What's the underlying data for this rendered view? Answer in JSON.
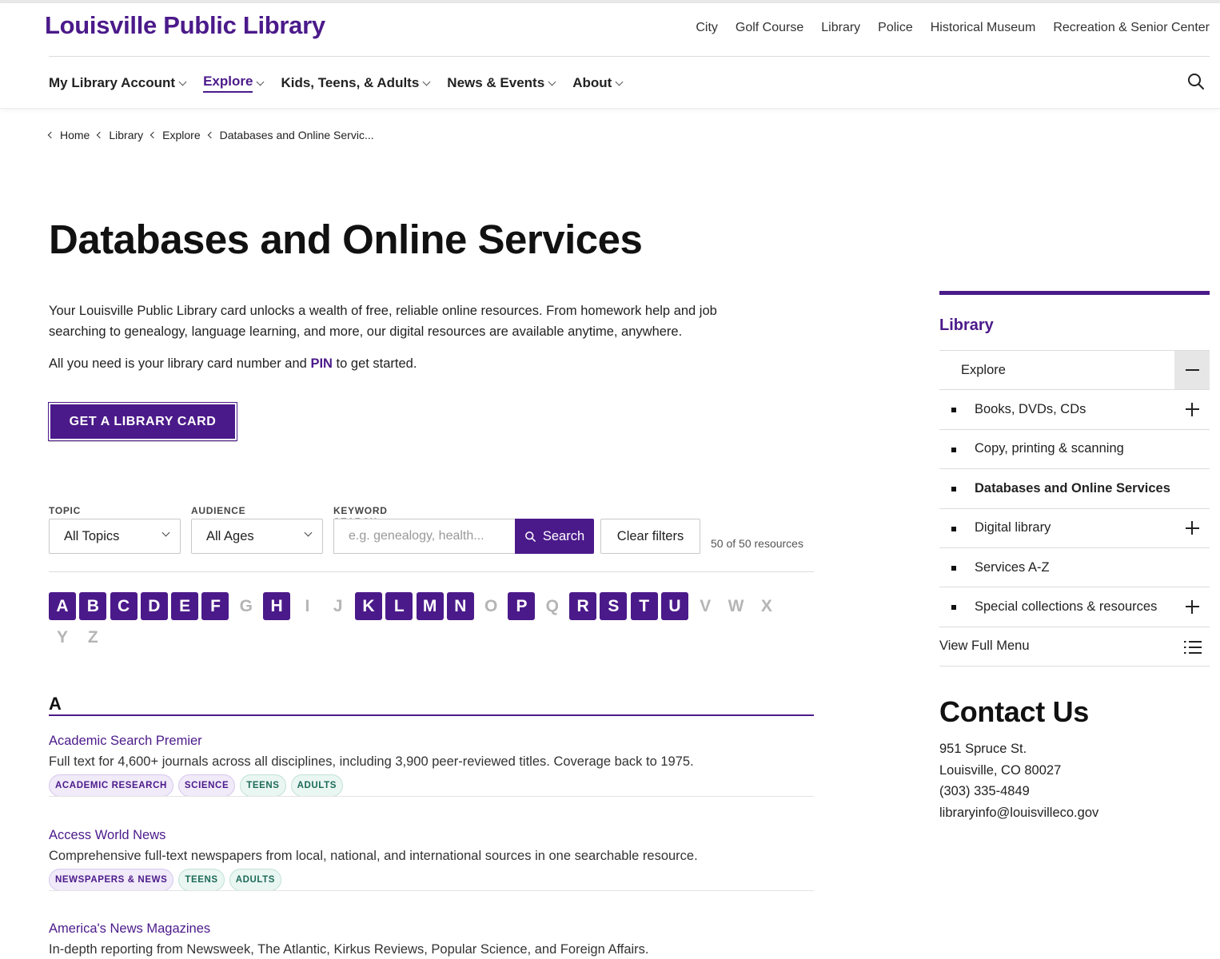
{
  "header": {
    "logo": "Louisville Public Library",
    "utility_links": [
      "City",
      "Golf Course",
      "Library",
      "Police",
      "Historical Museum",
      "Recreation & Senior Center"
    ],
    "nav": [
      {
        "label": "My Library Account",
        "active": false
      },
      {
        "label": "Explore",
        "active": true
      },
      {
        "label": "Kids, Teens, & Adults",
        "active": false
      },
      {
        "label": "News & Events",
        "active": false
      },
      {
        "label": "About",
        "active": false
      }
    ],
    "search_icon": "search-icon"
  },
  "breadcrumb": [
    "Home",
    "Library",
    "Explore",
    "Databases and Online Servic..."
  ],
  "page": {
    "title": "Databases and Online Services",
    "intro": "Your Louisville Public Library card unlocks a wealth of free, reliable online resources. From homework help and job searching to genealogy, language learning, and more, our digital resources are available anytime, anywhere.",
    "intro2_before": "All you need is your library card number and",
    "intro2_link": "PIN",
    "intro2_after": "to get started.",
    "cta": "GET A LIBRARY CARD"
  },
  "filters": {
    "topic_label": "TOPIC",
    "topic_value": "All Topics",
    "audience_label": "AUDIENCE",
    "audience_value": "All Ages",
    "keyword_label": "KEYWORD SEARCH",
    "keyword_placeholder": "e.g. genealogy, health...",
    "search_button": "Search",
    "clear_button": "Clear filters",
    "count": "50 of 50 resources"
  },
  "alphabet": {
    "enabled": [
      "A",
      "B",
      "C",
      "D",
      "E",
      "F",
      "H",
      "K",
      "L",
      "M",
      "N",
      "P",
      "R",
      "S",
      "T",
      "U"
    ],
    "letters": [
      "A",
      "B",
      "C",
      "D",
      "E",
      "F",
      "G",
      "H",
      "I",
      "J",
      "K",
      "L",
      "M",
      "N",
      "O",
      "P",
      "Q",
      "R",
      "S",
      "T",
      "U",
      "V",
      "W",
      "X",
      "Y",
      "Z"
    ]
  },
  "section_letter": "A",
  "resources": [
    {
      "title": "Academic Search Premier",
      "description": "Full text for 4,600+ journals across all disciplines, including 3,900 peer-reviewed titles. Coverage back to 1975.",
      "topic_tags": [
        "ACADEMIC RESEARCH",
        "SCIENCE"
      ],
      "audience_tags": [
        "TEENS",
        "ADULTS"
      ]
    },
    {
      "title": "Access World News",
      "description": "Comprehensive full-text newspapers from local, national, and international sources in one searchable resource.",
      "topic_tags": [
        "NEWSPAPERS & NEWS"
      ],
      "audience_tags": [
        "TEENS",
        "ADULTS"
      ]
    },
    {
      "title": "America's News Magazines",
      "description": "In-depth reporting from Newsweek, The Atlantic, Kirkus Reviews, Popular Science, and Foreign Affairs.",
      "topic_tags": [],
      "audience_tags": []
    }
  ],
  "sidebar": {
    "title": "Library",
    "parent": "Explore",
    "items": [
      {
        "label": "Books, DVDs, CDs",
        "expandable": true,
        "current": false
      },
      {
        "label": "Copy, printing & scanning",
        "expandable": false,
        "current": false
      },
      {
        "label": "Databases and Online Services",
        "expandable": false,
        "current": true
      },
      {
        "label": "Digital library",
        "expandable": true,
        "current": false
      },
      {
        "label": "Services A-Z",
        "expandable": false,
        "current": false
      },
      {
        "label": "Special collections & resources",
        "expandable": true,
        "current": false
      }
    ],
    "full_menu": "View Full Menu"
  },
  "contact": {
    "title": "Contact Us",
    "address1": "951 Spruce St.",
    "address2": "Louisville, CO 80027",
    "phone": "(303) 335-4849",
    "email": "libraryinfo@louisvilleco.gov"
  },
  "colors": {
    "brand": "#4b1a8a",
    "tag_topic_bg": "#f0eaf9",
    "tag_audience_bg": "#eaf6f2"
  }
}
